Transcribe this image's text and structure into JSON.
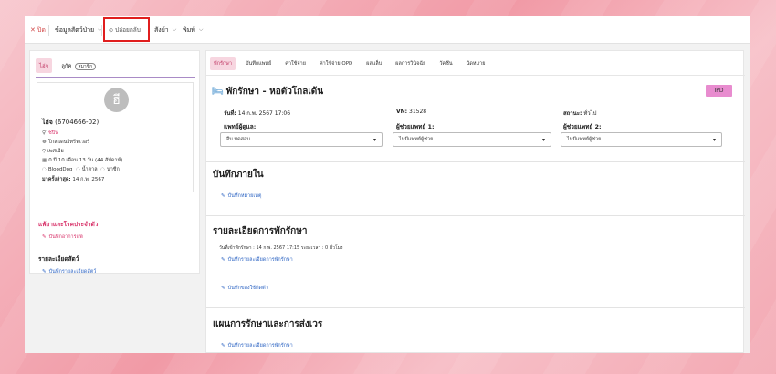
{
  "toolbar": {
    "close": "ปิด",
    "patient_info": "ข้อมูลสัตว์ป่วย",
    "release": "ปล่อยกลับ",
    "order": "สั่งย้า",
    "print": "พิมพ์"
  },
  "left": {
    "tabs": [
      "ไฮ่จ",
      "ลูกัค"
    ],
    "chip": "สมาชิก",
    "avatar_letter": "ฮี",
    "patient": {
      "name": "ไฮ่จ",
      "id": "(6704666-02)",
      "sex": "ชปิษ",
      "owner": "โกลแดนรีทรีฟเวอร์",
      "breed": "เพศเมีย",
      "age": "0 ปี 10 เดือน 13 วัน (44 สัปดาห์)",
      "blood": "BloodDog",
      "t1": "น้ำตาล",
      "t2": "นาชีก",
      "last_visit_label": "มาครั้งล่าสุด:",
      "last_visit": "14 ก.พ. 2567"
    },
    "allergy_title": "แพ้ยาและโรคประจำตัว",
    "allergy_link": "บันทึกอาการแพ้",
    "detail_title": "รายละเอียดสัตว์",
    "detail_link": "บันทึกรายละเอียดสัตว์"
  },
  "right": {
    "tabs": [
      "พักรักษา",
      "บันทึกแพทย์",
      "ค่าใช้จ่าย",
      "ค่าใช้จ่าย OPD",
      "ผลแล็บ",
      "ผลการวินิจฉัย",
      "วัคซีน",
      "นัดหมาย"
    ],
    "title": "พักรักษา - หอตัวโกลเด้น",
    "badge": "IPD",
    "date_label": "วันที่:",
    "date": "14 ก.พ. 2567 17:06",
    "vn_label": "VN:",
    "vn": "31528",
    "status_label": "สถานะ:",
    "status": "ทั่วไป",
    "doctor_label": "แพทย์ผู้ดูแล:",
    "assistant1_label": "ผู้ช่วยแพทย์ 1:",
    "assistant2_label": "ผู้ช่วยแพทย์ 2:",
    "doctor_value": "จีบ ทดสอบ",
    "assistant1_value": "ไม่มีแพทย์ผู้ช่วย",
    "assistant2_value": "ไม่มีแพทย์ผู้ช่วย",
    "sec1_title": "บันทึกภายใน",
    "sec1_link": "บันทึกหมายเหตุ",
    "sec2_title": "รายละเอียดการพักรักษา",
    "admit_line": "วันที่เข้าพักรักษา : 14 ก.พ. 2567 17:15 ระยะเวลา : 0 ชั่วโมง",
    "sec2_link1": "บันทึกรายละเอียดการพักรักษา",
    "sec2_link2": "บันทึกของใช้ติดตัว",
    "sec3_title": "แผนการรักษาและการส่งเวร",
    "sec3_link": "บันทึกรายละเอียดการพักรักษา"
  }
}
